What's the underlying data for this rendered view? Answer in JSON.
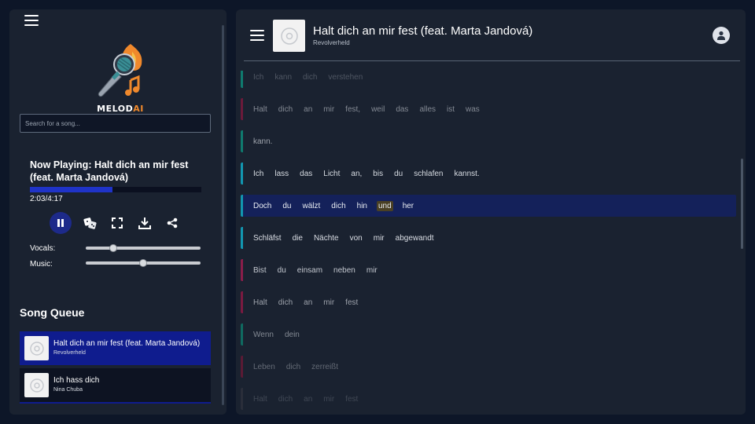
{
  "sidebar": {
    "logo": {
      "text_main": "MELOD",
      "text_accent": "AI"
    },
    "search_placeholder": "Search for a song...",
    "now_playing": "Now Playing: Halt dich an mir fest (feat. Marta Jandová)",
    "progress_fraction": 0.48,
    "time": "2:03/4:17",
    "controls": [
      "pause-icon",
      "dice-icon",
      "fullscreen-icon",
      "download-icon",
      "share-icon"
    ],
    "vocals_label": "Vocals:",
    "vocals_level": 0.22,
    "music_label": "Music:",
    "music_level": 0.5,
    "queue_title": "Song Queue",
    "queue": [
      {
        "title": "Halt dich an mir fest (feat. Marta Jandová)",
        "artist": "Revolverheld",
        "active": true
      },
      {
        "title": "Ich hass dich",
        "artist": "Nina Chuba",
        "active": false
      }
    ]
  },
  "player": {
    "title": "Halt dich an mir fest (feat. Marta Jandová)",
    "artist": "Revolverheld"
  },
  "lyrics": [
    {
      "words": [
        "Ich",
        "kann",
        "dich",
        "verstehen"
      ],
      "bar": "#0f7a6e",
      "opacity": 0.25
    },
    {
      "words": [
        "Halt",
        "dich",
        "an",
        "mir",
        "fest,",
        "weil",
        "das",
        "alles",
        "ist",
        "was"
      ],
      "bar": "#6b1a3a",
      "opacity": 0.5
    },
    {
      "words": [
        "kann."
      ],
      "bar": "#0f7a6e",
      "opacity": 0.62
    },
    {
      "words": [
        "Ich",
        "lass",
        "das",
        "Licht",
        "an,",
        "bis",
        "du",
        "schlafen",
        "kannst."
      ],
      "bar": "#1296b0",
      "opacity": 0.9
    },
    {
      "words": [
        "Doch",
        "du",
        "wälzt",
        "dich",
        "hin",
        "und",
        "her"
      ],
      "bar": "#1296b0",
      "opacity": 1,
      "current": true,
      "highlight_index": 5
    },
    {
      "words": [
        "Schläfst",
        "die",
        "Nächte",
        "von",
        "mir",
        "abgewandt"
      ],
      "bar": "#1296b0",
      "opacity": 0.92
    },
    {
      "words": [
        "Bist",
        "du",
        "einsam",
        "neben",
        "mir"
      ],
      "bar": "#8a1e4a",
      "opacity": 0.8
    },
    {
      "words": [
        "Halt",
        "dich",
        "an",
        "mir",
        "fest"
      ],
      "bar": "#7a1a40",
      "opacity": 0.62
    },
    {
      "words": [
        "Wenn",
        "dein"
      ],
      "bar": "#0f6a60",
      "opacity": 0.5
    },
    {
      "words": [
        "Leben",
        "dich",
        "zerreißt"
      ],
      "bar": "#5a1a34",
      "opacity": 0.35
    },
    {
      "words": [
        "Halt",
        "dich",
        "an",
        "mir",
        "fest"
      ],
      "bar": "#2a2e3a",
      "opacity": 0.18
    }
  ],
  "colors": {
    "accent": "#1f33c8",
    "queue_active": "#0f1c8e",
    "current_line": "#14215a",
    "word_highlight": "#4a4024"
  }
}
